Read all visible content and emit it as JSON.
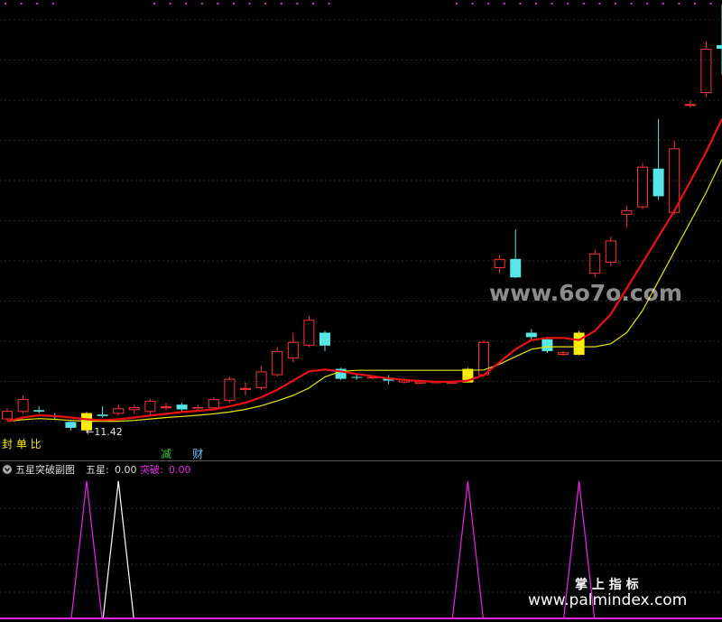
{
  "chart_data": [
    {
      "type": "candlestick",
      "panel": "main",
      "low_label": "←11.42",
      "bottom_left_label": "封 单 比",
      "markers": [
        {
          "text": "减",
          "candle_index": 10,
          "color": "#33cc33"
        },
        {
          "text": "财",
          "candle_index": 12,
          "color": "#66ccff"
        }
      ],
      "colors": {
        "up": "#ff3333",
        "down": "#55e6e6",
        "signal": "#ffee00",
        "ma_fast": "#ee1111",
        "ma_slow": "#e6e600"
      },
      "candles": [
        {
          "o": 11.75,
          "h": 12.05,
          "l": 11.7,
          "c": 11.98,
          "s": "up"
        },
        {
          "o": 11.95,
          "h": 12.4,
          "l": 11.9,
          "c": 12.3,
          "s": "up"
        },
        {
          "o": 12.0,
          "h": 12.1,
          "l": 11.92,
          "c": 11.96,
          "s": "down"
        },
        {
          "o": 11.85,
          "h": 11.92,
          "l": 11.74,
          "c": 11.82,
          "s": "down"
        },
        {
          "o": 11.68,
          "h": 11.7,
          "l": 11.45,
          "c": 11.52,
          "s": "down"
        },
        {
          "o": 11.45,
          "h": 11.95,
          "l": 11.42,
          "c": 11.92,
          "s": "signal"
        },
        {
          "o": 11.88,
          "h": 12.1,
          "l": 11.8,
          "c": 11.84,
          "s": "down"
        },
        {
          "o": 11.9,
          "h": 12.15,
          "l": 11.85,
          "c": 12.05,
          "s": "up"
        },
        {
          "o": 12.0,
          "h": 12.15,
          "l": 11.9,
          "c": 12.08,
          "s": "up"
        },
        {
          "o": 11.95,
          "h": 12.3,
          "l": 11.88,
          "c": 12.25,
          "s": "up"
        },
        {
          "o": 12.1,
          "h": 12.2,
          "l": 12.0,
          "c": 12.05,
          "s": "up"
        },
        {
          "o": 12.15,
          "h": 12.2,
          "l": 11.95,
          "c": 12.02,
          "s": "down"
        },
        {
          "o": 12.05,
          "h": 12.15,
          "l": 11.98,
          "c": 12.08,
          "s": "up"
        },
        {
          "o": 12.05,
          "h": 12.35,
          "l": 12.0,
          "c": 12.3,
          "s": "up"
        },
        {
          "o": 12.25,
          "h": 12.9,
          "l": 12.2,
          "c": 12.85,
          "s": "up"
        },
        {
          "o": 12.55,
          "h": 12.75,
          "l": 12.4,
          "c": 12.6,
          "s": "up"
        },
        {
          "o": 12.6,
          "h": 13.2,
          "l": 12.55,
          "c": 13.05,
          "s": "up"
        },
        {
          "o": 12.95,
          "h": 13.7,
          "l": 12.9,
          "c": 13.6,
          "s": "up"
        },
        {
          "o": 13.4,
          "h": 14.1,
          "l": 13.3,
          "c": 13.85,
          "s": "up"
        },
        {
          "o": 13.75,
          "h": 14.55,
          "l": 13.7,
          "c": 14.45,
          "s": "up"
        },
        {
          "o": 14.1,
          "h": 14.15,
          "l": 13.6,
          "c": 13.75,
          "s": "down"
        },
        {
          "o": 13.12,
          "h": 13.15,
          "l": 12.82,
          "c": 12.85,
          "s": "down"
        },
        {
          "o": 12.9,
          "h": 12.98,
          "l": 12.82,
          "c": 12.88,
          "s": "down"
        },
        {
          "o": 12.86,
          "h": 12.92,
          "l": 12.84,
          "c": 12.9,
          "s": "up"
        },
        {
          "o": 12.88,
          "h": 12.95,
          "l": 12.7,
          "c": 12.8,
          "s": "down"
        },
        {
          "o": 12.75,
          "h": 12.86,
          "l": 12.72,
          "c": 12.84,
          "s": "up"
        },
        {
          "o": 12.72,
          "h": 12.82,
          "l": 12.7,
          "c": 12.78,
          "s": "up"
        },
        {
          "o": 12.74,
          "h": 12.8,
          "l": 12.72,
          "c": 12.77,
          "s": "up"
        },
        {
          "o": 12.72,
          "h": 12.8,
          "l": 12.7,
          "c": 12.78,
          "s": "up"
        },
        {
          "o": 12.75,
          "h": 13.15,
          "l": 12.74,
          "c": 13.12,
          "s": "signal"
        },
        {
          "o": 12.95,
          "h": 13.9,
          "l": 12.9,
          "c": 13.85,
          "s": "up"
        },
        {
          "o": 15.85,
          "h": 16.2,
          "l": 15.7,
          "c": 16.1,
          "s": "up"
        },
        {
          "o": 16.1,
          "h": 16.9,
          "l": 15.58,
          "c": 15.6,
          "s": "down"
        },
        {
          "o": 14.1,
          "h": 14.2,
          "l": 13.92,
          "c": 13.98,
          "s": "down"
        },
        {
          "o": 13.92,
          "h": 13.95,
          "l": 13.55,
          "c": 13.6,
          "s": "down"
        },
        {
          "o": 13.5,
          "h": 13.6,
          "l": 13.48,
          "c": 13.57,
          "s": "up"
        },
        {
          "o": 13.5,
          "h": 14.15,
          "l": 13.48,
          "c": 14.1,
          "s": "signal"
        },
        {
          "o": 15.7,
          "h": 16.35,
          "l": 15.6,
          "c": 16.25,
          "s": "up"
        },
        {
          "o": 16.0,
          "h": 16.7,
          "l": 15.9,
          "c": 16.6,
          "s": "up"
        },
        {
          "o": 17.3,
          "h": 17.55,
          "l": 16.95,
          "c": 17.42,
          "s": "up"
        },
        {
          "o": 17.5,
          "h": 18.7,
          "l": 17.45,
          "c": 18.6,
          "s": "up"
        },
        {
          "o": 18.55,
          "h": 19.9,
          "l": 17.7,
          "c": 17.8,
          "s": "down"
        },
        {
          "o": 17.35,
          "h": 19.3,
          "l": 17.3,
          "c": 19.1,
          "s": "up"
        },
        {
          "o": 20.25,
          "h": 20.4,
          "l": 20.2,
          "c": 20.3,
          "s": "up"
        },
        {
          "o": 20.6,
          "h": 22.0,
          "l": 20.5,
          "c": 21.8,
          "s": "up"
        },
        {
          "o": 21.9,
          "h": 23.0,
          "l": 21.1,
          "c": 21.8,
          "s": "down"
        }
      ],
      "ma_fast": [
        11.7,
        11.8,
        11.86,
        11.84,
        11.8,
        11.75,
        11.73,
        11.75,
        11.8,
        11.85,
        11.9,
        11.95,
        11.98,
        12.02,
        12.1,
        12.2,
        12.35,
        12.55,
        12.8,
        13.05,
        13.1,
        13.05,
        12.98,
        12.92,
        12.86,
        12.82,
        12.79,
        12.77,
        12.77,
        12.8,
        12.95,
        13.3,
        13.65,
        13.9,
        13.96,
        13.96,
        13.9,
        14.15,
        14.6,
        15.3,
        16.0,
        16.7,
        17.4,
        18.2,
        19.0,
        19.9
      ],
      "ma_slow": [
        11.7,
        11.74,
        11.77,
        11.75,
        11.72,
        11.7,
        11.7,
        11.7,
        11.72,
        11.76,
        11.8,
        11.83,
        11.86,
        11.9,
        11.95,
        12.02,
        12.12,
        12.25,
        12.4,
        12.6,
        12.9,
        13.05,
        13.08,
        13.08,
        13.08,
        13.08,
        13.08,
        13.08,
        13.08,
        13.08,
        13.09,
        13.25,
        13.45,
        13.65,
        13.72,
        13.72,
        13.72,
        13.72,
        13.8,
        14.1,
        14.7,
        15.5,
        16.3,
        17.1,
        17.9,
        18.8
      ]
    },
    {
      "type": "spikes",
      "panel": "sub",
      "title": "五星突破副图",
      "legend": [
        {
          "label": "五星:",
          "value": "0.00",
          "color": "#dddddd"
        },
        {
          "label": "突破:",
          "value": "0.00",
          "color": "#ee22ee"
        }
      ],
      "spikes": [
        {
          "candle_index": 5,
          "series": "突破",
          "color": "#ee22ee"
        },
        {
          "candle_index": 7,
          "series": "五星",
          "color": "#ffffff"
        },
        {
          "candle_index": 29,
          "series": "突破",
          "color": "#ee22ee"
        },
        {
          "candle_index": 36,
          "series": "突破",
          "color": "#ee22ee"
        }
      ]
    }
  ],
  "watermarks": {
    "center": "www.6o7o.com",
    "bottom_title": "掌 上 指 标",
    "bottom_url": "www.palmindex.com"
  }
}
